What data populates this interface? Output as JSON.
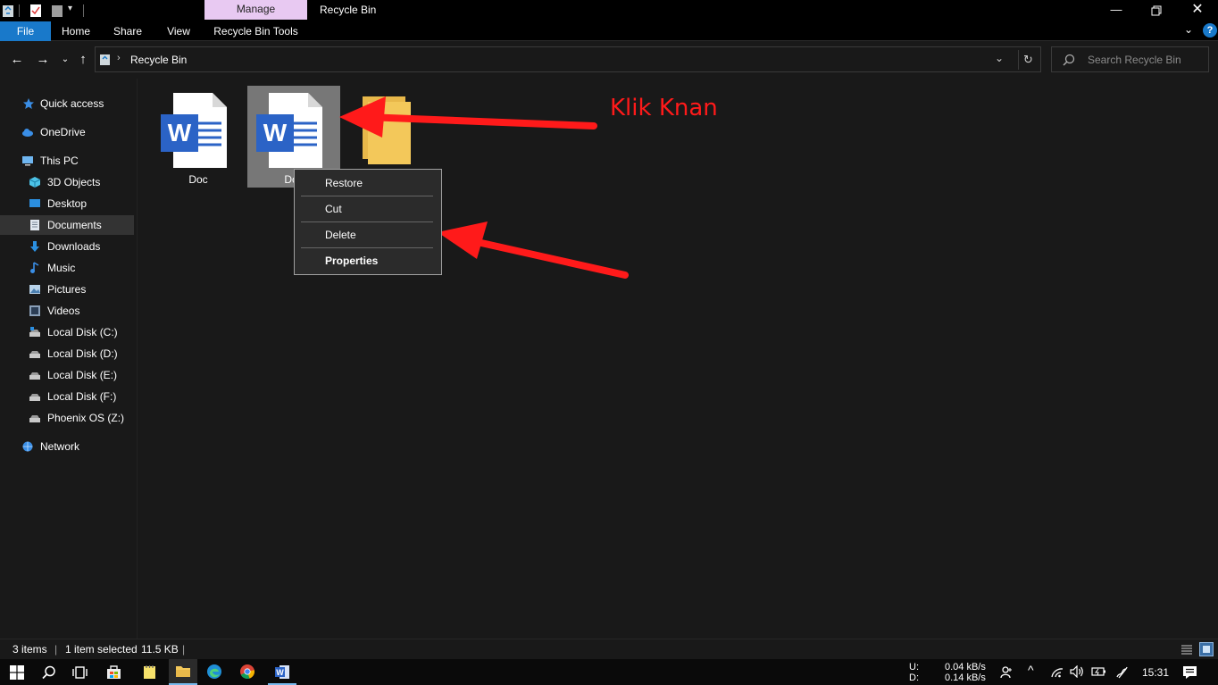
{
  "window": {
    "title": "Recycle Bin",
    "contextual_tab": "Manage"
  },
  "ribbon": {
    "tabs": [
      "File",
      "Home",
      "Share",
      "View",
      "Recycle Bin Tools"
    ]
  },
  "address": {
    "path": "Recycle Bin",
    "search_placeholder": "Search Recycle Bin"
  },
  "nav": {
    "items": [
      {
        "label": "Quick access",
        "icon": "star-icon"
      },
      {
        "label": "OneDrive",
        "icon": "cloud-icon"
      },
      {
        "label": "This PC",
        "icon": "computer-icon"
      },
      {
        "label": "3D Objects",
        "icon": "cube-icon"
      },
      {
        "label": "Desktop",
        "icon": "desktop-icon"
      },
      {
        "label": "Documents",
        "icon": "document-icon"
      },
      {
        "label": "Downloads",
        "icon": "download-icon"
      },
      {
        "label": "Music",
        "icon": "music-icon"
      },
      {
        "label": "Pictures",
        "icon": "pictures-icon"
      },
      {
        "label": "Videos",
        "icon": "videos-icon"
      },
      {
        "label": "Local Disk (C:)",
        "icon": "drive-icon"
      },
      {
        "label": "Local Disk (D:)",
        "icon": "drive-icon"
      },
      {
        "label": "Local Disk (E:)",
        "icon": "drive-icon"
      },
      {
        "label": "Local Disk (F:)",
        "icon": "drive-icon"
      },
      {
        "label": "Phoenix OS (Z:)",
        "icon": "drive-icon"
      },
      {
        "label": "Network",
        "icon": "network-icon"
      }
    ]
  },
  "files": [
    {
      "label": "Doc",
      "icon": "word-document-icon"
    },
    {
      "label": "Doc",
      "icon": "word-document-icon"
    },
    {
      "label": "",
      "icon": "folder-icon"
    }
  ],
  "context_menu": {
    "items": [
      "Restore",
      "Cut",
      "Delete",
      "Properties"
    ]
  },
  "annotation": {
    "text": "Klik Knan",
    "color": "#ff1a1a"
  },
  "status": {
    "count": "3 items",
    "selection": "1 item selected",
    "size": "11.5 KB"
  },
  "taskbar": {
    "net_upload_label": "U:",
    "net_download_label": "D:",
    "net_upload": "0.04 kB/s",
    "net_download": "0.14 kB/s",
    "time": "15:31"
  },
  "colors": {
    "accent": "#1979ca",
    "manage_tab": "#e8c9f2",
    "word_blue": "#2b63c6",
    "folder_yellow": "#f3c85a"
  }
}
